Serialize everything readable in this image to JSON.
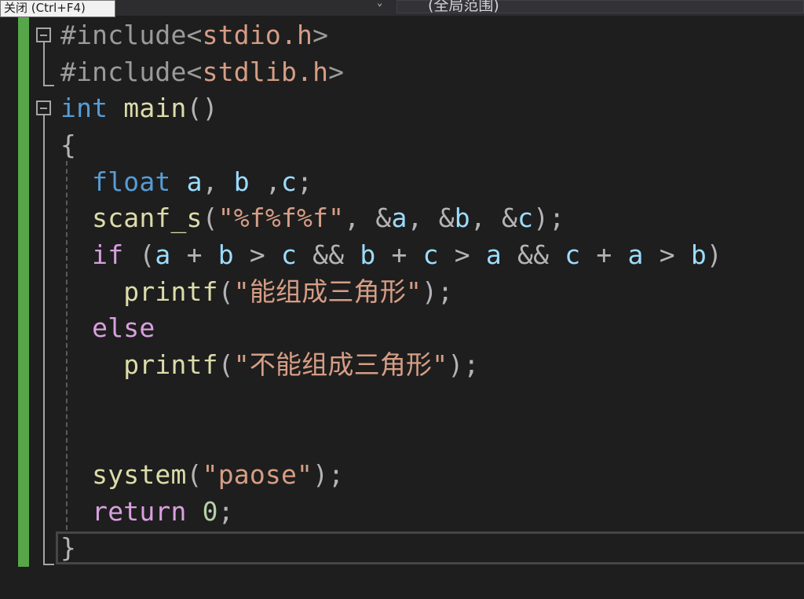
{
  "nav": {
    "tooltip": "关闭 (Ctrl+F4)",
    "scope": "(全局范围)"
  },
  "code": {
    "l1": {
      "hash": "#include",
      "lt": "<",
      "path": "stdio.h",
      "gt": ">"
    },
    "l2": {
      "hash": "#include",
      "lt": "<",
      "path": "stdlib.h",
      "gt": ">"
    },
    "l3": {
      "type": "int",
      "name": "main",
      "parens": "()"
    },
    "l4": {
      "brace": "{"
    },
    "l5": {
      "type": "float",
      "a": "a",
      "c1": ", ",
      "b": "b",
      "c2": " ,",
      "c": "c",
      "semi": ";"
    },
    "l6": {
      "fn": "scanf_s",
      "open": "(",
      "fmt": "\"%f%f%f\"",
      "c1": ", ",
      "amp1": "&",
      "a": "a",
      "c2": ", ",
      "amp2": "&",
      "b": "b",
      "c3": ", ",
      "amp3": "&",
      "c": "c",
      "close": ");"
    },
    "l7": {
      "kw": "if",
      "open": " (",
      "a1": "a",
      "op1": " + ",
      "b1": "b",
      "gt1": " > ",
      "c1": "c",
      "and1": " && ",
      "b2": "b",
      "op2": " + ",
      "c2": "c",
      "gt2": " > ",
      "a2": "a",
      "and2": " && ",
      "c3": "c",
      "op3": " + ",
      "a3": "a",
      "gt3": " > ",
      "b3": "b",
      "close": ")"
    },
    "l8": {
      "fn": "printf",
      "open": "(",
      "str": "\"能组成三角形\"",
      "close": ");"
    },
    "l9": {
      "kw": "else"
    },
    "l10": {
      "fn": "printf",
      "open": "(",
      "str": "\"不能组成三角形\"",
      "close": ");"
    },
    "l13": {
      "fn": "system",
      "open": "(",
      "str": "\"paose\"",
      "close": ");"
    },
    "l14": {
      "kw": "return",
      "num": "0",
      "semi": ";"
    },
    "l15": {
      "brace": "}"
    }
  },
  "colors": {
    "background": "#1e1e1e",
    "change_bar": "#57a64a",
    "keyword": "#569cd6",
    "control": "#d8a0df",
    "function": "#dcdcaa",
    "variable": "#9cdcfe",
    "string": "#d69d85",
    "number": "#b5cea8"
  },
  "icons": [
    "fold-collapse-icon",
    "dropdown-arrow-icon"
  ]
}
